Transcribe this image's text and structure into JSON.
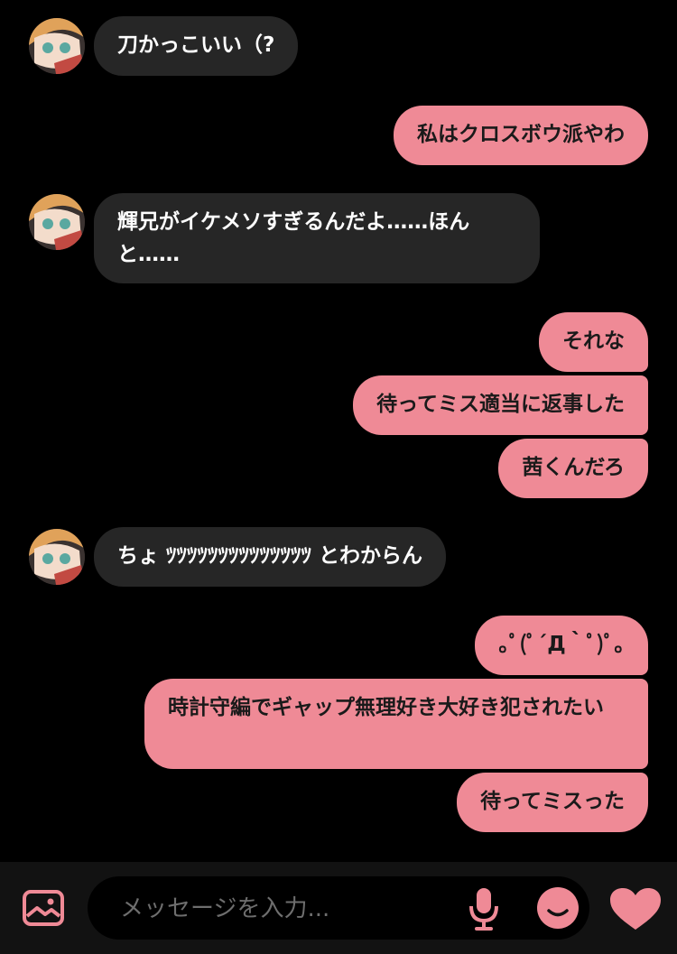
{
  "messages": [
    {
      "side": "in",
      "text": "刀かっこいい（?"
    },
    {
      "side": "out",
      "text": "私はクロスボウ派やわ"
    },
    {
      "side": "in",
      "text": "輝兄がイケメソすぎるんだよ……ほんと……"
    },
    {
      "side": "out",
      "text": "それな"
    },
    {
      "side": "out",
      "text": "待ってミス適当に返事した"
    },
    {
      "side": "out",
      "text": "茜くんだろ"
    },
    {
      "side": "in",
      "text": "ちょ ﾂﾂﾂﾂﾂﾂﾂﾂﾂﾂﾂﾂﾂﾂ とわからん"
    },
    {
      "side": "out",
      "text": "｡ﾟ(ﾟ´Д｀ﾟ)ﾟ｡"
    },
    {
      "side": "out",
      "text": "時計守編でギャップ無理好き大好き犯されたい"
    },
    {
      "side": "out",
      "text": "待ってミスった"
    }
  ],
  "composer": {
    "placeholder": "メッセージを入力...",
    "icons": [
      "image-icon",
      "microphone-icon",
      "sticker-icon",
      "heart-icon"
    ]
  },
  "colors": {
    "background": "#000000",
    "incoming_bubble": "#262626",
    "outgoing_bubble": "#ef8a96",
    "accent": "#ef8a96"
  }
}
